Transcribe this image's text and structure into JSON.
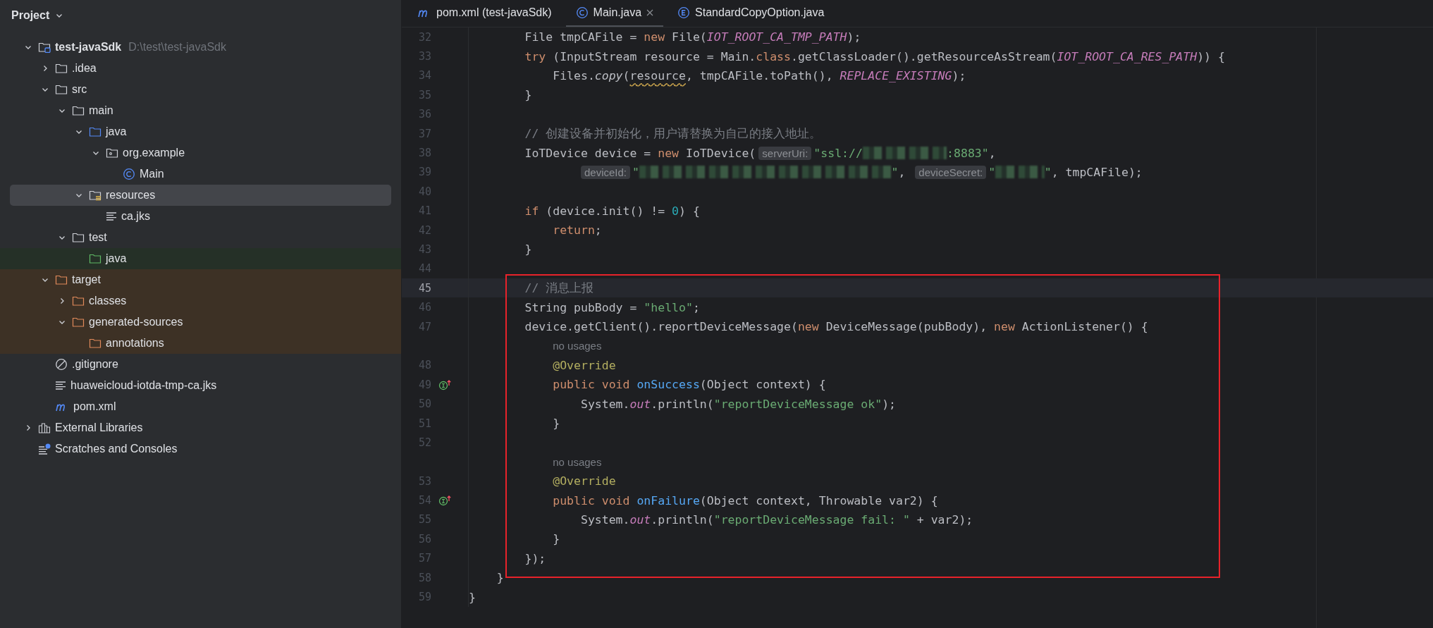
{
  "sidebar": {
    "title": "Project",
    "tree": [
      {
        "label": "test-javaSdk",
        "path": "D:\\test\\test-javaSdk",
        "kind": "module",
        "expanded": true,
        "selected": false,
        "children": [
          {
            "label": ".idea",
            "kind": "folder",
            "expanded": false,
            "selected": false
          },
          {
            "label": "src",
            "kind": "folder",
            "expanded": true,
            "selected": false,
            "children": [
              {
                "label": "main",
                "kind": "folder",
                "expanded": true,
                "selected": false,
                "children": [
                  {
                    "label": "java",
                    "kind": "source",
                    "expanded": true,
                    "selected": false,
                    "children": [
                      {
                        "label": "org.example",
                        "kind": "package",
                        "expanded": true,
                        "selected": false,
                        "children": [
                          {
                            "label": "Main",
                            "kind": "class",
                            "selected": false
                          }
                        ]
                      }
                    ]
                  },
                  {
                    "label": "resources",
                    "kind": "resources",
                    "expanded": true,
                    "selected": true,
                    "children": [
                      {
                        "label": "ca.jks",
                        "kind": "text",
                        "selected": false
                      }
                    ]
                  }
                ]
              },
              {
                "label": "test",
                "kind": "folder",
                "expanded": true,
                "selected": false,
                "children": [
                  {
                    "label": "java",
                    "kind": "test",
                    "selected": false
                  }
                ]
              }
            ]
          },
          {
            "label": "target",
            "kind": "excluded",
            "expanded": true,
            "selected": false,
            "children": [
              {
                "label": "classes",
                "kind": "excluded",
                "expanded": false,
                "selected": false
              },
              {
                "label": "generated-sources",
                "kind": "excluded",
                "expanded": true,
                "selected": false,
                "children": [
                  {
                    "label": "annotations",
                    "kind": "excluded",
                    "selected": false
                  }
                ]
              }
            ]
          },
          {
            "label": ".gitignore",
            "kind": "ignore",
            "selected": false
          },
          {
            "label": "huaweicloud-iotda-tmp-ca.jks",
            "kind": "text",
            "selected": false
          },
          {
            "label": "pom.xml",
            "kind": "maven",
            "selected": false
          }
        ]
      },
      {
        "label": "External Libraries",
        "kind": "libraries",
        "expanded": false,
        "selected": false
      },
      {
        "label": "Scratches and Consoles",
        "kind": "scratches",
        "selected": false
      }
    ]
  },
  "tabs": [
    {
      "label": "pom.xml (test-javaSdk)",
      "kind": "maven",
      "selected": false
    },
    {
      "label": "Main.java",
      "kind": "class",
      "selected": true
    },
    {
      "label": "StandardCopyOption.java",
      "kind": "enum",
      "selected": false
    }
  ],
  "editor": {
    "blocks": [
      {
        "framed": false,
        "lines": [
          {
            "kind": "code",
            "number": "32",
            "current": false,
            "tokens": [
              {
                "kind": "plain",
                "text": "        File tmpCAFile = "
              },
              {
                "kind": "keyword",
                "text": "new "
              },
              {
                "kind": "plain",
                "text": "File("
              },
              {
                "kind": "constant",
                "text": "IOT_ROOT_CA_TMP_PATH"
              },
              {
                "kind": "plain",
                "text": ");"
              }
            ]
          },
          {
            "kind": "code",
            "number": "33",
            "current": false,
            "tokens": [
              {
                "kind": "keyword",
                "text": "        try "
              },
              {
                "kind": "plain",
                "text": "(InputStream resource = Main."
              },
              {
                "kind": "keyword",
                "text": "class"
              },
              {
                "kind": "plain",
                "text": ".getClassLoader().getResourceAsStream("
              },
              {
                "kind": "constant",
                "text": "IOT_ROOT_CA_RES_PATH"
              },
              {
                "kind": "plain",
                "text": ")) {"
              }
            ]
          },
          {
            "kind": "code",
            "number": "34",
            "current": false,
            "tokens": [
              {
                "kind": "plain",
                "text": "            Files."
              },
              {
                "kind": "static",
                "text": "copy"
              },
              {
                "kind": "plain",
                "text": "("
              },
              {
                "kind": "warning",
                "text": "resource"
              },
              {
                "kind": "plain",
                "text": ", tmpCAFile.toPath(), "
              },
              {
                "kind": "constant",
                "text": "REPLACE_EXISTING"
              },
              {
                "kind": "plain",
                "text": ");"
              }
            ]
          },
          {
            "kind": "code",
            "number": "35",
            "current": false,
            "tokens": [
              {
                "kind": "plain",
                "text": "        }"
              }
            ]
          },
          {
            "kind": "code",
            "number": "36",
            "current": false
          },
          {
            "kind": "code",
            "number": "37",
            "current": false,
            "tokens": [
              {
                "kind": "comment",
                "text": "        // 创建设备并初始化，用户请替换为自己的接入地址。"
              }
            ]
          },
          {
            "kind": "code",
            "number": "38",
            "current": false,
            "tokens": [
              {
                "kind": "plain",
                "text": "        IoTDevice device = "
              },
              {
                "kind": "keyword",
                "text": "new "
              },
              {
                "kind": "plain",
                "text": "IoTDevice("
              },
              {
                "kind": "hint",
                "text": "serverUri:"
              },
              {
                "kind": "string",
                "text": "\"ssl://"
              },
              {
                "kind": "redacted"
              },
              {
                "kind": "string",
                "text": ":8883\""
              },
              {
                "kind": "plain",
                "text": ","
              }
            ]
          },
          {
            "kind": "code",
            "number": "39",
            "current": false,
            "tokens": [
              {
                "kind": "hint",
                "text": "deviceId:"
              },
              {
                "kind": "string",
                "text": "\""
              },
              {
                "kind": "redacted"
              },
              {
                "kind": "string",
                "text": "\""
              },
              {
                "kind": "plain",
                "text": ", "
              },
              {
                "kind": "hint",
                "text": "deviceSecret:"
              },
              {
                "kind": "string",
                "text": "\""
              },
              {
                "kind": "redacted"
              },
              {
                "kind": "string",
                "text": "\""
              },
              {
                "kind": "plain",
                "text": ", tmpCAFile);"
              }
            ]
          },
          {
            "kind": "code",
            "number": "40",
            "current": false
          },
          {
            "kind": "code",
            "number": "41",
            "current": false,
            "tokens": [
              {
                "kind": "keyword",
                "text": "        if "
              },
              {
                "kind": "plain",
                "text": "(device.init() != "
              },
              {
                "kind": "number",
                "text": "0"
              },
              {
                "kind": "plain",
                "text": ") {"
              }
            ]
          },
          {
            "kind": "code",
            "number": "42",
            "current": false,
            "tokens": [
              {
                "kind": "keyword",
                "text": "            return"
              },
              {
                "kind": "plain",
                "text": ";"
              }
            ]
          },
          {
            "kind": "code",
            "number": "43",
            "current": false,
            "tokens": [
              {
                "kind": "plain",
                "text": "        }"
              }
            ]
          },
          {
            "kind": "code",
            "number": "44",
            "current": false
          }
        ]
      },
      {
        "framed": true,
        "lines": [
          {
            "kind": "code",
            "number": "45",
            "current": true,
            "tokens": [
              {
                "kind": "comment",
                "text": "        // 消息上报"
              }
            ]
          },
          {
            "kind": "code",
            "number": "46",
            "current": false,
            "tokens": [
              {
                "kind": "plain",
                "text": "        String pubBody = "
              },
              {
                "kind": "string",
                "text": "\"hello\""
              },
              {
                "kind": "plain",
                "text": ";"
              }
            ]
          },
          {
            "kind": "code",
            "number": "47",
            "current": false,
            "tokens": [
              {
                "kind": "plain",
                "text": "        device.getClient().reportDeviceMessage("
              },
              {
                "kind": "keyword",
                "text": "new "
              },
              {
                "kind": "plain",
                "text": "DeviceMessage(pubBody), "
              },
              {
                "kind": "keyword",
                "text": "new "
              },
              {
                "kind": "plain",
                "text": "ActionListener() {"
              }
            ]
          },
          {
            "kind": "inlay",
            "text": "no usages"
          },
          {
            "kind": "code",
            "number": "48",
            "current": false,
            "tokens": [
              {
                "kind": "annotation",
                "text": "            @Override"
              }
            ]
          },
          {
            "kind": "method",
            "number": "49",
            "current": false,
            "tokens": [
              {
                "kind": "keyword",
                "text": "            public void "
              },
              {
                "kind": "declaration",
                "text": "onSuccess"
              },
              {
                "kind": "plain",
                "text": "(Object context) {"
              }
            ]
          },
          {
            "kind": "code",
            "number": "50",
            "current": false,
            "tokens": [
              {
                "kind": "plain",
                "text": "                System."
              },
              {
                "kind": "field",
                "text": "out"
              },
              {
                "kind": "plain",
                "text": ".println("
              },
              {
                "kind": "string",
                "text": "\"reportDeviceMessage ok\""
              },
              {
                "kind": "plain",
                "text": ");"
              }
            ]
          },
          {
            "kind": "code",
            "number": "51",
            "current": false,
            "tokens": [
              {
                "kind": "plain",
                "text": "            }"
              }
            ]
          },
          {
            "kind": "code",
            "number": "52",
            "current": false
          },
          {
            "kind": "inlay",
            "text": "no usages"
          },
          {
            "kind": "code",
            "number": "53",
            "current": false,
            "tokens": [
              {
                "kind": "annotation",
                "text": "            @Override"
              }
            ]
          },
          {
            "kind": "method",
            "number": "54",
            "current": false,
            "tokens": [
              {
                "kind": "keyword",
                "text": "            public void "
              },
              {
                "kind": "declaration",
                "text": "onFailure"
              },
              {
                "kind": "plain",
                "text": "(Object context, Throwable var2) {"
              }
            ]
          },
          {
            "kind": "code",
            "number": "55",
            "current": false,
            "tokens": [
              {
                "kind": "plain",
                "text": "                System."
              },
              {
                "kind": "field",
                "text": "out"
              },
              {
                "kind": "plain",
                "text": ".println("
              },
              {
                "kind": "string",
                "text": "\"reportDeviceMessage fail: \""
              },
              {
                "kind": "plain",
                "text": " + var2);"
              }
            ]
          },
          {
            "kind": "code",
            "number": "56",
            "current": false,
            "tokens": [
              {
                "kind": "plain",
                "text": "            }"
              }
            ]
          },
          {
            "kind": "code",
            "number": "57",
            "current": false,
            "tokens": [
              {
                "kind": "plain",
                "text": "        });"
              }
            ]
          },
          {
            "kind": "code",
            "number": "58",
            "current": false,
            "tokens": [
              {
                "kind": "plain",
                "text": "    }"
              }
            ]
          }
        ]
      },
      {
        "framed": false,
        "lines": [
          {
            "kind": "code",
            "number": "59",
            "current": false,
            "tokens": [
              {
                "kind": "plain",
                "text": "}"
              }
            ]
          }
        ]
      }
    ]
  }
}
